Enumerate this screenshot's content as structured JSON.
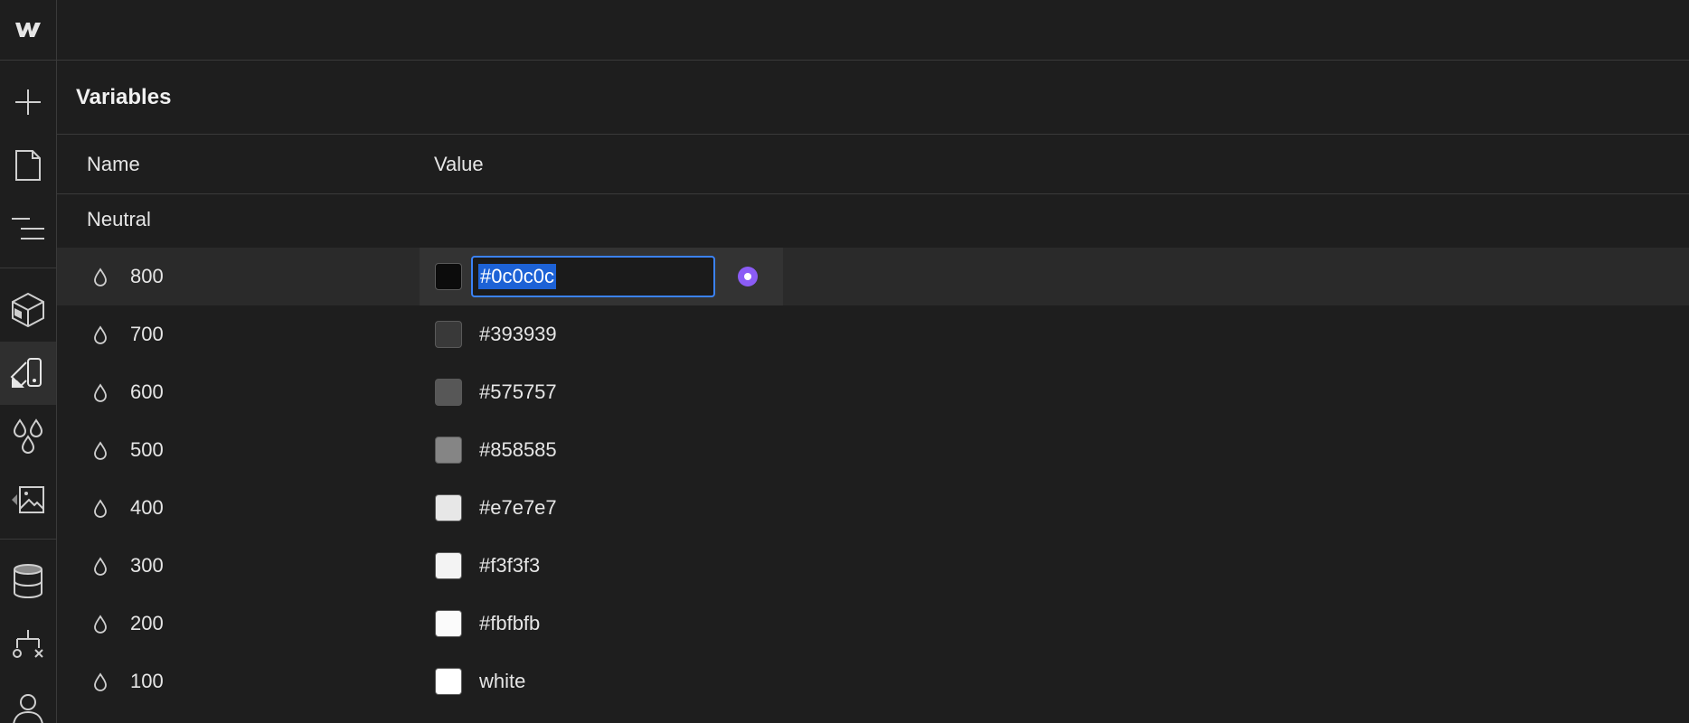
{
  "panel": {
    "title": "Variables",
    "columns": {
      "name": "Name",
      "value": "Value"
    }
  },
  "group": {
    "label": "Neutral"
  },
  "variables": [
    {
      "name": "800",
      "value": "#0c0c0c",
      "swatch": "#0c0c0c",
      "editing": true
    },
    {
      "name": "700",
      "value": "#393939",
      "swatch": "#393939"
    },
    {
      "name": "600",
      "value": "#575757",
      "swatch": "#575757"
    },
    {
      "name": "500",
      "value": "#858585",
      "swatch": "#858585"
    },
    {
      "name": "400",
      "value": "#e7e7e7",
      "swatch": "#e7e7e7"
    },
    {
      "name": "300",
      "value": "#f3f3f3",
      "swatch": "#f3f3f3"
    },
    {
      "name": "200",
      "value": "#fbfbfb",
      "swatch": "#fbfbfb"
    },
    {
      "name": "100",
      "value": "white",
      "swatch": "#ffffff"
    }
  ],
  "rail": {
    "icons": [
      "webflow-logo-icon",
      "add-icon",
      "pages-icon",
      "navigator-icon",
      "components-icon",
      "style-selectors-icon",
      "variables-icon",
      "assets-icon",
      "cms-icon",
      "logic-icon",
      "users-icon"
    ]
  },
  "colors": {
    "background": "#1e1e1e",
    "accent": "#3b82f6",
    "binding": "#8b5cf6"
  }
}
